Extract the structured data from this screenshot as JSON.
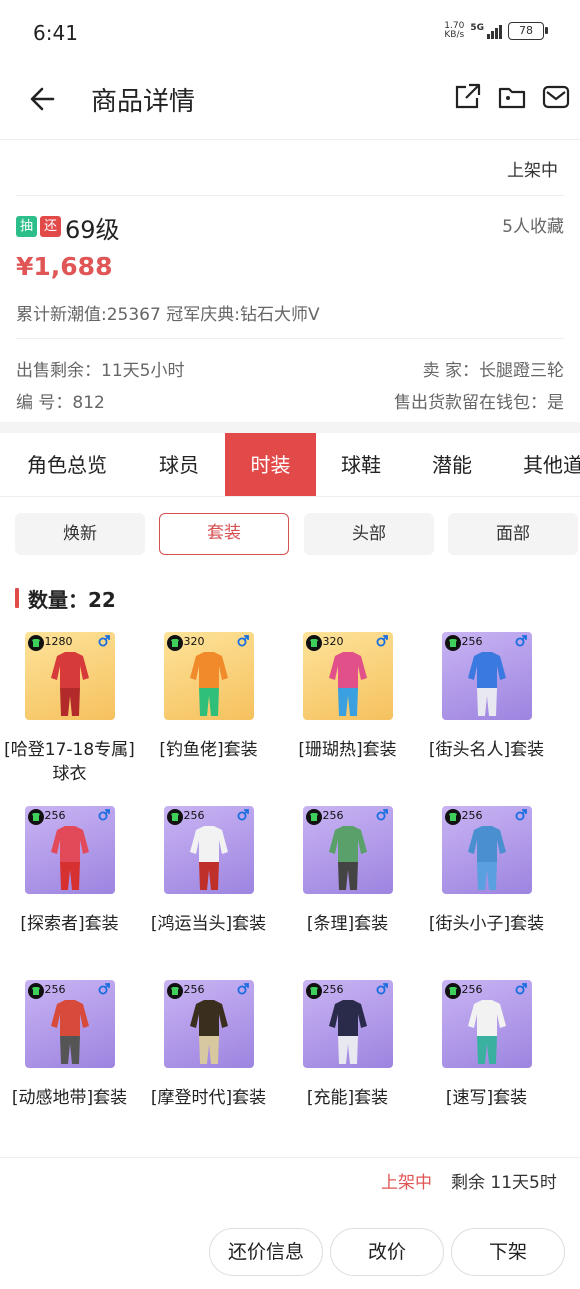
{
  "status_bar": {
    "time": "6:41",
    "net_speed_value": "1.70",
    "net_speed_unit": "KB/s",
    "network": "5G",
    "battery": "78"
  },
  "header": {
    "title": "商品详情",
    "icons": [
      "back-arrow-icon",
      "share-icon",
      "folder-icon",
      "mail-icon"
    ]
  },
  "listing": {
    "status": "上架中",
    "badge_draw": "抽",
    "badge_return": "还",
    "badge_colors": {
      "draw": "#2dbf8a",
      "return": "#e24a4a"
    },
    "level": "69级",
    "favorites": "5人收藏",
    "price": "¥1,688",
    "stats": "累计新潮值:25367 冠军庆典:钻石大师Ⅴ",
    "sale_remaining": "出售剩余：11天5小时",
    "seller": "卖  家：长腿蹬三轮",
    "serial": "编  号：812",
    "keep_in_wallet": "售出货款留在钱包：是"
  },
  "tabs": [
    {
      "label": "角色总览",
      "active": false
    },
    {
      "label": "球员",
      "active": false
    },
    {
      "label": "时装",
      "active": true
    },
    {
      "label": "球鞋",
      "active": false
    },
    {
      "label": "潜能",
      "active": false
    },
    {
      "label": "其他道",
      "active": false
    }
  ],
  "sub_tabs": [
    {
      "label": "焕新",
      "active": false
    },
    {
      "label": "套装",
      "active": true
    },
    {
      "label": "头部",
      "active": false
    },
    {
      "label": "面部",
      "active": false
    }
  ],
  "count_label": "数量：22",
  "items": [
    {
      "name": "[哈登17-18专属]球衣",
      "score": "1280",
      "tier": "gold"
    },
    {
      "name": "[钓鱼佬]套装",
      "score": "320",
      "tier": "gold"
    },
    {
      "name": "[珊瑚热]套装",
      "score": "320",
      "tier": "gold"
    },
    {
      "name": "[街头名人]套装",
      "score": "256",
      "tier": "purple"
    },
    {
      "name": "[探索者]套装",
      "score": "256",
      "tier": "purple"
    },
    {
      "name": "[鸿运当头]套装",
      "score": "256",
      "tier": "purple"
    },
    {
      "name": "[条理]套装",
      "score": "256",
      "tier": "purple"
    },
    {
      "name": "[街头小子]套装",
      "score": "256",
      "tier": "purple"
    },
    {
      "name": "[动感地带]套装",
      "score": "256",
      "tier": "purple"
    },
    {
      "name": "[摩登时代]套装",
      "score": "256",
      "tier": "purple"
    },
    {
      "name": "[充能]套装",
      "score": "256",
      "tier": "purple"
    },
    {
      "name": "[速写]套装",
      "score": "256",
      "tier": "purple"
    }
  ],
  "bottom_bar": {
    "status": "上架中",
    "remaining": "剩余 11天5时",
    "buttons": [
      "还价信息",
      "改价",
      "下架"
    ]
  },
  "colors": {
    "accent": "#e24a4a",
    "price": "#e05555",
    "gold_tier": "#f6c15e",
    "purple_tier": "#9d84e0"
  }
}
